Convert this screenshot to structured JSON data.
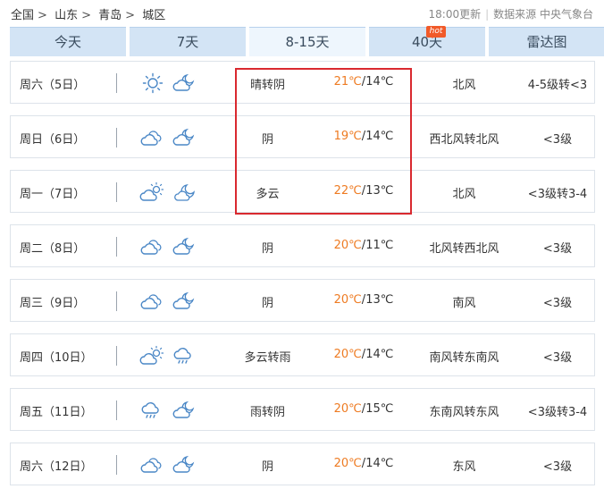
{
  "breadcrumb": [
    "全国",
    "山东",
    "青岛",
    "城区"
  ],
  "breadcrumb_separator": ">",
  "update": "18:00更新",
  "source_label": "数据来源 中央气象台",
  "tabs": [
    {
      "label": "今天"
    },
    {
      "label": "7天"
    },
    {
      "label": "8-15天"
    },
    {
      "label": "40天",
      "badge": "hot"
    },
    {
      "label": "雷达图"
    }
  ],
  "colors": {
    "high_temp": "#ee7b22",
    "highlight_border": "#d9292f",
    "tab_bg": "#d3e4f5",
    "tab_active_bg": "#eef6fd"
  },
  "temp_separator": "/",
  "days": [
    {
      "day": "周六（5日）",
      "icon_day": "sun-icon",
      "icon_night": "cloudy-night-icon",
      "weather": "晴转阴",
      "high": "21℃",
      "low": "14℃",
      "wind": "北风",
      "level": "4-5级转<3"
    },
    {
      "day": "周日（6日）",
      "icon_day": "overcast-icon",
      "icon_night": "cloudy-night-icon",
      "weather": "阴",
      "high": "19℃",
      "low": "14℃",
      "wind": "西北风转北风",
      "level": "<3级"
    },
    {
      "day": "周一（7日）",
      "icon_day": "partly-cloudy-icon",
      "icon_night": "moon-icon",
      "weather": "多云",
      "high": "22℃",
      "low": "13℃",
      "wind": "北风",
      "level": "<3级转3-4"
    },
    {
      "day": "周二（8日）",
      "icon_day": "overcast-icon",
      "icon_night": "cloudy-night-icon",
      "weather": "阴",
      "high": "20℃",
      "low": "11℃",
      "wind": "北风转西北风",
      "level": "<3级"
    },
    {
      "day": "周三（9日）",
      "icon_day": "overcast-icon",
      "icon_night": "cloudy-night-icon",
      "weather": "阴",
      "high": "20℃",
      "low": "13℃",
      "wind": "南风",
      "level": "<3级"
    },
    {
      "day": "周四（10日）",
      "icon_day": "partly-cloudy-icon",
      "icon_night": "rain-icon",
      "weather": "多云转雨",
      "high": "20℃",
      "low": "14℃",
      "wind": "南风转东南风",
      "level": "<3级"
    },
    {
      "day": "周五（11日）",
      "icon_day": "rain-icon",
      "icon_night": "cloudy-night-icon",
      "weather": "雨转阴",
      "high": "20℃",
      "low": "15℃",
      "wind": "东南风转东风",
      "level": "<3级转3-4"
    },
    {
      "day": "周六（12日）",
      "icon_day": "overcast-icon",
      "icon_night": "cloudy-night-icon",
      "weather": "阴",
      "high": "20℃",
      "low": "14℃",
      "wind": "东风",
      "level": "<3级"
    }
  ]
}
